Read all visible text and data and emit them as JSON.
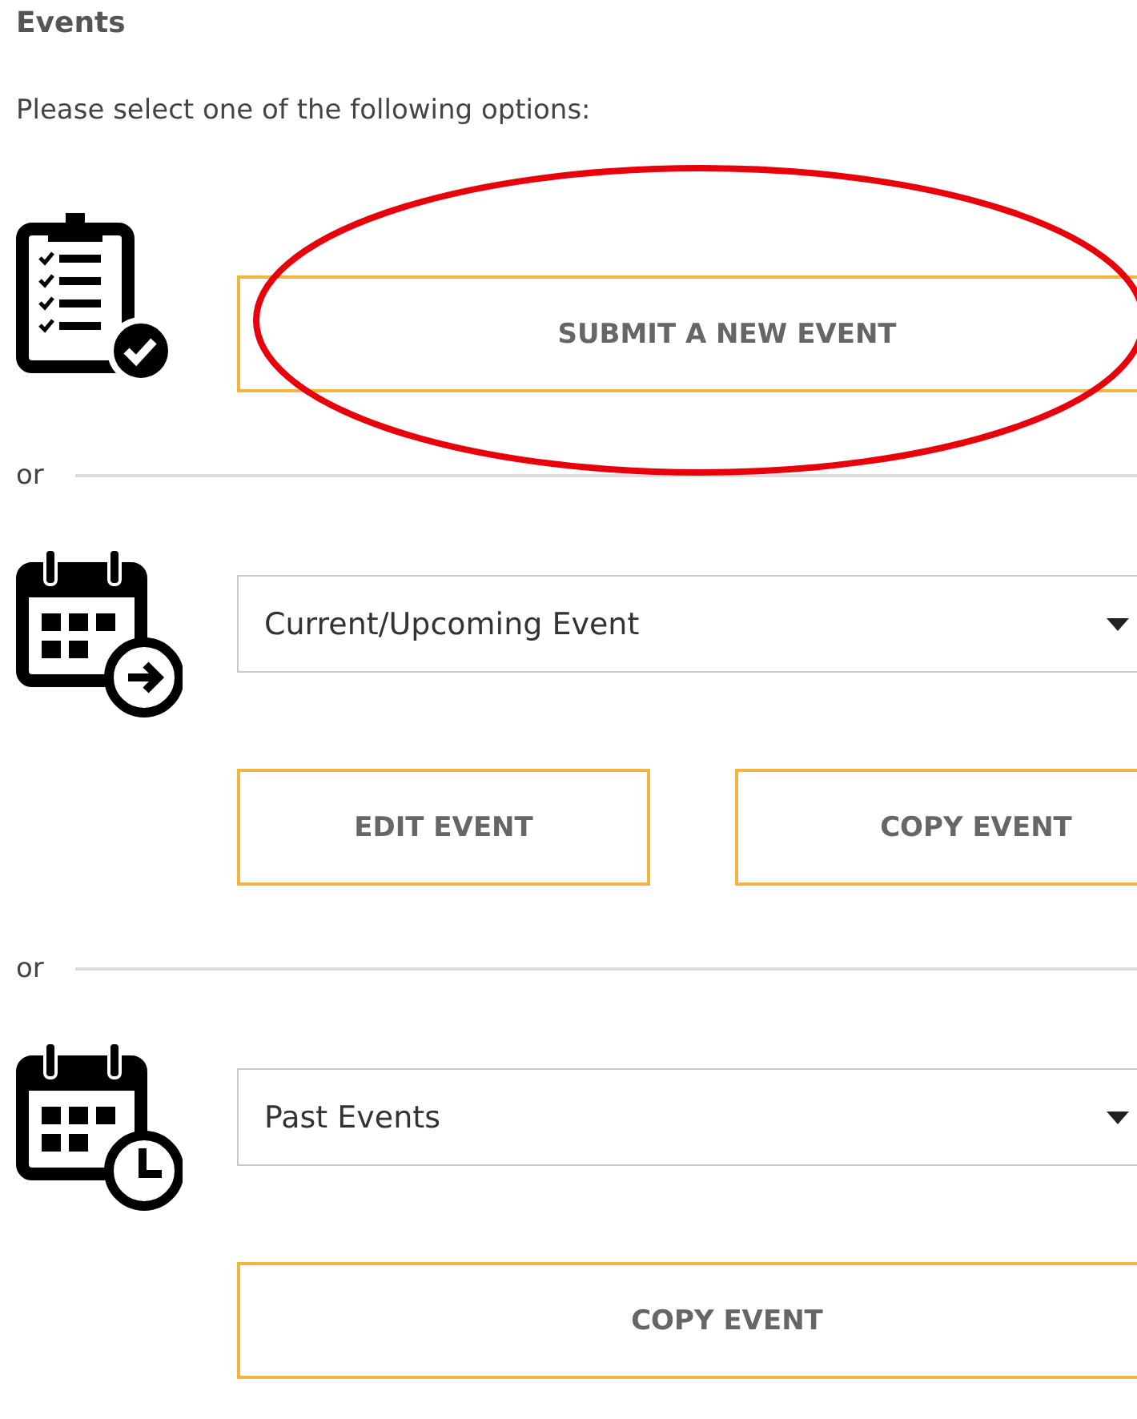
{
  "title": "Events",
  "intro": "Please select one of the following options:",
  "sections": [
    {
      "kind": "clipboard",
      "buttons": [
        "SUBMIT A NEW EVENT"
      ]
    },
    {
      "divider": "or",
      "kind": "calendar-arrow",
      "dropdown": {
        "value": "Current/Upcoming Event"
      },
      "buttons": [
        "EDIT EVENT",
        "COPY EVENT"
      ]
    },
    {
      "divider": "or",
      "kind": "calendar-clock",
      "dropdown": {
        "value": "Past Events"
      },
      "buttons": [
        "COPY EVENT"
      ]
    }
  ],
  "annotation": {
    "kind": "ellipse"
  }
}
